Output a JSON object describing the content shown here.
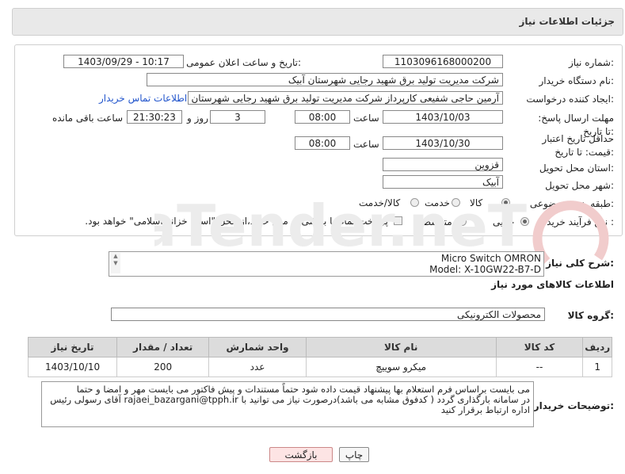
{
  "header": {
    "title": "جزئیات اطلاعات نیاز"
  },
  "form": {
    "need_number_label": "شماره نیاز:",
    "need_number": "1103096168000200",
    "announce_label": "تاریخ و ساعت اعلان عمومی:",
    "announce_value": "1403/09/29 - 10:17",
    "buyer_label": "نام دستگاه خریدار:",
    "buyer_value": "شرکت مدیریت تولید برق شهید رجایی شهرستان آبیک",
    "creator_label": "ایجاد کننده درخواست:",
    "creator_value": "آرمین حاجی شفیعی کارپرداز شرکت مدیریت تولید برق شهید رجایی شهرستان",
    "contact_link": "اطلاعات تماس خریدار",
    "deadline_label": "مهلت ارسال پاسخ: تا تاریخ:",
    "deadline_date": "1403/10/03",
    "time_label": "ساعت",
    "deadline_time": "08:00",
    "days_value": "3",
    "days_label": "روز و",
    "remaining_time": "21:30:23",
    "remaining_label": "ساعت باقی مانده",
    "validity_label": "حداقل تاریخ اعتبار قیمت: تا تاریخ:",
    "validity_date": "1403/10/30",
    "validity_time": "08:00",
    "province_label": "استان محل تحویل:",
    "province_value": "قزوین",
    "city_label": "شهر محل تحویل:",
    "city_value": "آبیک",
    "category_label": "طبقه بندی موضوعی:",
    "category_options": [
      "کالا",
      "خدمت",
      "کالا/خدمت"
    ],
    "purchase_label": "نوع فرآیند خرید :",
    "purchase_options": [
      "جزیی",
      "متوسط"
    ],
    "payment_note": "پرداخت تمام یا بخشی از مبلغ خرید،از محل \"اسناد خزانه اسلامی\" خواهد بود."
  },
  "description": {
    "label": "شرح کلی نیاز:",
    "line1": "Micro Switch  OMRON",
    "line2": "Model: X-10GW22-B7-D"
  },
  "goods": {
    "section_title": "اطلاعات کالاهای مورد نیاز",
    "group_label": "گروه کالا:",
    "group_value": "محصولات الکترونیکی",
    "columns": [
      "ردیف",
      "کد کالا",
      "نام کالا",
      "واحد شمارش",
      "تعداد / مقدار",
      "تاریخ نیاز"
    ],
    "rows": [
      {
        "row": "1",
        "code": "--",
        "name": "میکرو سوییچ",
        "unit": "عدد",
        "qty": "200",
        "date": "1403/10/10"
      }
    ]
  },
  "buyer_notes": {
    "label": "توضیحات خریدار:",
    "line1": "می بایست براساس فرم استعلام بها پیشنهاد قیمت داده شود حتماً مستندات و پیش فاکتور می بایست مهر و امضا و حتما",
    "line2": "در سامانه بارگذاری گردد ( کدفوق مشابه می باشد)درصورت نیاز می توانید با rajaei_bazargani@tpph.ir آقای رسولی رئیس",
    "line3": "اداره ارتباط برقرار کنید"
  },
  "buttons": {
    "print": "چاپ",
    "back": "بازگشت"
  },
  "watermark": {
    "text": "AriaTender.neT"
  },
  "colors": {
    "link": "#2255cc",
    "back_button_bg": "#fde4e4",
    "back_button_border": "#c88",
    "header_bg": "#e9e9e9"
  }
}
